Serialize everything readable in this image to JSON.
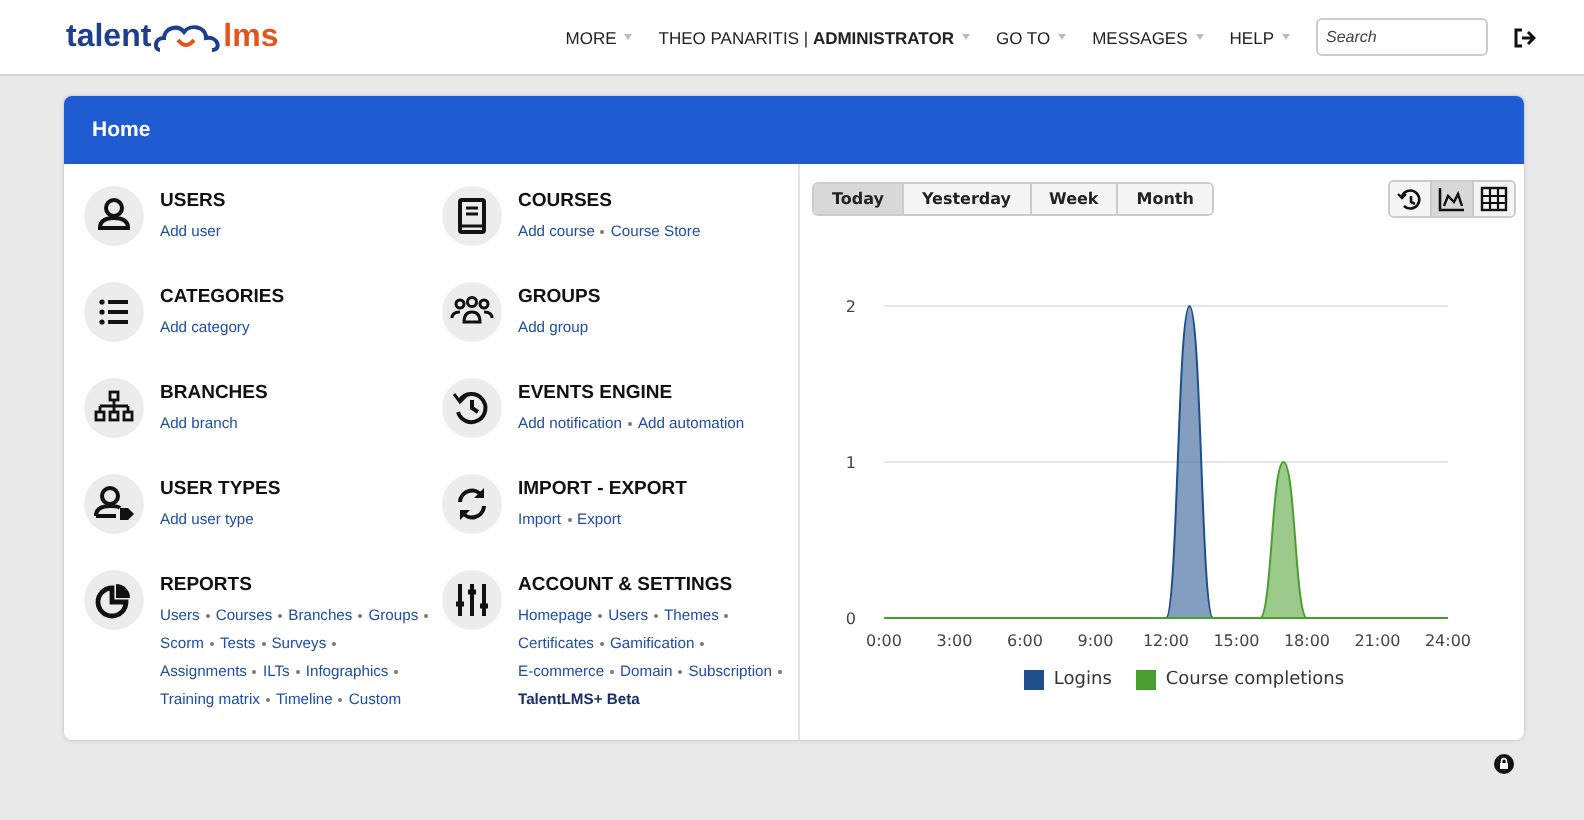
{
  "header": {
    "logo": {
      "part_1": "talent",
      "part_2": "lms"
    },
    "nav": [
      {
        "label": "MORE"
      },
      {
        "label": "THEO PANARITIS | **ADMINISTRATOR**"
      },
      {
        "label": "GO TO"
      },
      {
        "label": "MESSAGES"
      },
      {
        "label": "HELP"
      }
    ],
    "search": {
      "placeholder": "Search"
    }
  },
  "panel": {
    "title": "Home"
  },
  "sections": [
    {
      "kind": "users",
      "title": "USERS",
      "links": [
        {
          "label": "Add user",
          "bold": false
        }
      ]
    },
    {
      "kind": "courses",
      "title": "COURSES",
      "links": [
        {
          "label": "Add course",
          "bold": false
        },
        {
          "label": "Course Store",
          "bold": false
        }
      ]
    },
    {
      "kind": "categories",
      "title": "CATEGORIES",
      "links": [
        {
          "label": "Add category",
          "bold": false
        }
      ]
    },
    {
      "kind": "groups",
      "title": "GROUPS",
      "links": [
        {
          "label": "Add group",
          "bold": false
        }
      ]
    },
    {
      "kind": "branches",
      "title": "BRANCHES",
      "links": [
        {
          "label": "Add branch",
          "bold": false
        }
      ]
    },
    {
      "kind": "events",
      "title": "EVENTS ENGINE",
      "links": [
        {
          "label": "Add notification",
          "bold": false
        },
        {
          "label": "Add automation",
          "bold": false
        }
      ]
    },
    {
      "kind": "user_types",
      "title": "USER TYPES",
      "links": [
        {
          "label": "Add user type",
          "bold": false
        }
      ]
    },
    {
      "kind": "import_export",
      "title": "IMPORT - EXPORT",
      "links": [
        {
          "label": "Import",
          "bold": false
        },
        {
          "label": "Export",
          "bold": false
        }
      ]
    },
    {
      "kind": "reports",
      "title": "REPORTS",
      "links": [
        {
          "label": "Users",
          "bold": false
        },
        {
          "label": "Courses",
          "bold": false
        },
        {
          "label": "Branches",
          "bold": false
        },
        {
          "label": "Groups",
          "bold": false
        },
        {
          "label": "Scorm",
          "bold": false
        },
        {
          "label": "Tests",
          "bold": false
        },
        {
          "label": "Surveys",
          "bold": false
        },
        {
          "label": "Assignments",
          "bold": false
        },
        {
          "label": "ILTs",
          "bold": false
        },
        {
          "label": "Infographics",
          "bold": false
        },
        {
          "label": "Training matrix",
          "bold": false
        },
        {
          "label": "Timeline",
          "bold": false
        },
        {
          "label": "Custom",
          "bold": false
        }
      ]
    },
    {
      "kind": "settings",
      "title": "ACCOUNT & SETTINGS",
      "links": [
        {
          "label": "Homepage",
          "bold": false
        },
        {
          "label": "Users",
          "bold": false
        },
        {
          "label": "Themes",
          "bold": false
        },
        {
          "label": "Certificates",
          "bold": false
        },
        {
          "label": "Gamification",
          "bold": false
        },
        {
          "label": "E-commerce",
          "bold": false
        },
        {
          "label": "Domain",
          "bold": false
        },
        {
          "label": "Subscription",
          "bold": false
        },
        {
          "label": "TalentLMS+ Beta",
          "bold": true
        }
      ]
    }
  ],
  "period_tabs": [
    {
      "label": "Today",
      "selected": true
    },
    {
      "label": "Yesterday",
      "selected": false
    },
    {
      "label": "Week",
      "selected": false
    },
    {
      "label": "Month",
      "selected": false
    }
  ],
  "view_buttons": [
    {
      "kind": "history",
      "selected": false
    },
    {
      "kind": "chart",
      "selected": true
    },
    {
      "kind": "table",
      "selected": false
    }
  ],
  "chart_data": {
    "type": "area",
    "x": [
      0,
      1,
      2,
      3,
      4,
      5,
      6,
      7,
      8,
      9,
      10,
      11,
      12,
      13,
      14,
      15,
      16,
      17,
      18,
      19,
      20,
      21,
      22,
      23,
      24
    ],
    "xlim": [
      0,
      24
    ],
    "ylim": [
      0,
      2
    ],
    "xticks": [
      {
        "value": 0,
        "label": "0:00"
      },
      {
        "value": 3,
        "label": "3:00"
      },
      {
        "value": 6,
        "label": "6:00"
      },
      {
        "value": 9,
        "label": "9:00"
      },
      {
        "value": 12,
        "label": "12:00"
      },
      {
        "value": 15,
        "label": "15:00"
      },
      {
        "value": 18,
        "label": "18:00"
      },
      {
        "value": 21,
        "label": "21:00"
      },
      {
        "value": 24,
        "label": "24:00"
      }
    ],
    "yticks": [
      0,
      1,
      2
    ],
    "series": [
      {
        "name": "Logins",
        "color": "#1f4e8c",
        "values": [
          0,
          0,
          0,
          0,
          0,
          0,
          0,
          0,
          0,
          0,
          0,
          0,
          0,
          2,
          0,
          0,
          0,
          0,
          0,
          0,
          0,
          0,
          0,
          0,
          0
        ]
      },
      {
        "name": "Course completions",
        "color": "#4a9e2f",
        "values": [
          0,
          0,
          0,
          0,
          0,
          0,
          0,
          0,
          0,
          0,
          0,
          0,
          0,
          0,
          0,
          0,
          0,
          1,
          0,
          0,
          0,
          0,
          0,
          0,
          0
        ]
      }
    ]
  }
}
